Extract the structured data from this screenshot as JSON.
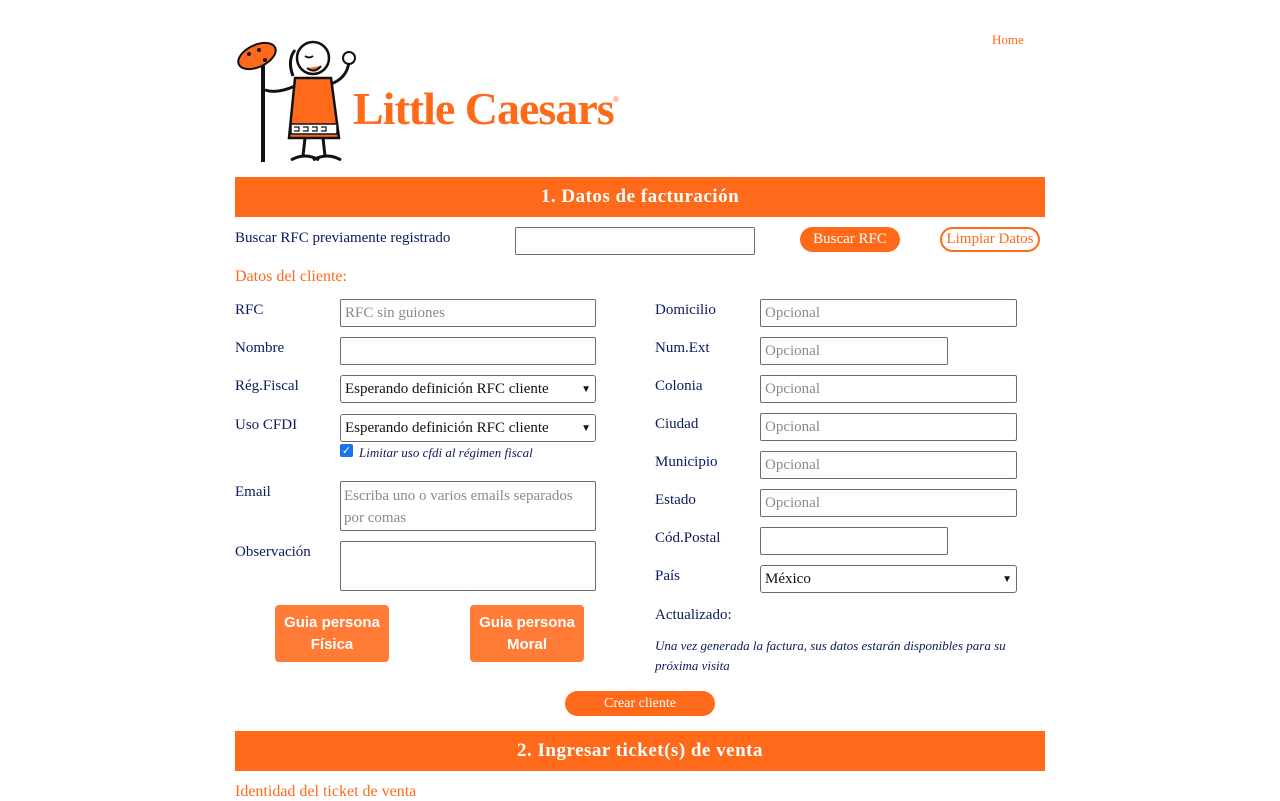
{
  "nav": {
    "home_label": "Home"
  },
  "brand": {
    "logo_text": "Little Caesars"
  },
  "section1": {
    "title": "1. Datos de facturación",
    "search_label": "Buscar RFC previamente registrado",
    "search_value": "",
    "search_button": "Buscar RFC",
    "clear_button": "Limpiar Datos",
    "client_heading": "Datos del cliente:",
    "left": {
      "rfc_label": "RFC",
      "rfc_placeholder": "RFC sin guiones",
      "nombre_label": "Nombre",
      "nombre_value": "",
      "regfiscal_label": "Rég.Fiscal",
      "regfiscal_value": "Esperando definición RFC cliente",
      "usocfdi_label": "Uso CFDI",
      "usocfdi_value": "Esperando definición RFC cliente",
      "limit_checkbox_label": "Limitar uso cfdi al régimen fiscal",
      "limit_checked": true,
      "email_label": "Email",
      "email_placeholder": "Escriba uno o varios emails separados por comas",
      "obs_label": "Observación",
      "obs_value": ""
    },
    "right": {
      "domicilio_label": "Domicilio",
      "numext_label": "Num.Ext",
      "colonia_label": "Colonia",
      "ciudad_label": "Ciudad",
      "municipio_label": "Municipio",
      "estado_label": "Estado",
      "cp_label": "Cód.Postal",
      "pais_label": "País",
      "pais_value": "México",
      "optional_placeholder": "Opcional",
      "updated_label": "Actualizado:",
      "note": "Una vez generada la factura, sus datos estarán disponibles para su próxima visita"
    },
    "guide_fisica": [
      "Guia persona",
      "Física"
    ],
    "guide_moral": [
      "Guia persona",
      "Moral"
    ],
    "create_button": "Crear cliente"
  },
  "section2": {
    "title": "2. Ingresar ticket(s) de venta",
    "subheading": "Identidad del ticket de venta"
  },
  "colors": {
    "accent": "#ff6a1a",
    "label": "#0a1a5c"
  }
}
